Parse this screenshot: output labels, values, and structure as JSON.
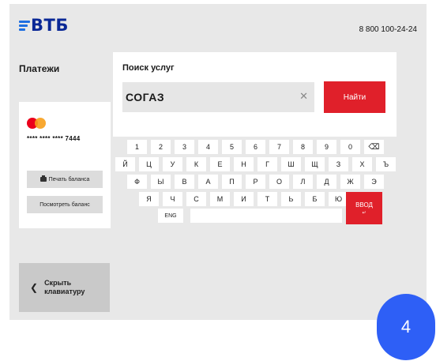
{
  "header": {
    "brand": "ВТБ",
    "phone": "8 800 100-24-24"
  },
  "left": {
    "title": "Платежи",
    "card_number": "**** **** **** 7444",
    "print_balance_label": "Печать баланса",
    "view_balance_label": "Посмотреть баланс",
    "hide_keyboard_label": "Скрыть клавиатуру"
  },
  "search": {
    "title": "Поиск услуг",
    "value": "СОГАЗ",
    "clear_icon": "✕",
    "find_label": "Найти"
  },
  "keyboard": {
    "row1": [
      "1",
      "2",
      "3",
      "4",
      "5",
      "6",
      "7",
      "8",
      "9",
      "0",
      "⌫"
    ],
    "row2": [
      "Й",
      "Ц",
      "У",
      "К",
      "Е",
      "Н",
      "Г",
      "Ш",
      "Щ",
      "З",
      "Х",
      "Ъ"
    ],
    "row3": [
      "Ф",
      "Ы",
      "В",
      "А",
      "П",
      "Р",
      "О",
      "Л",
      "Д",
      "Ж",
      "Э"
    ],
    "row4": [
      "Я",
      "Ч",
      "С",
      "М",
      "И",
      "Т",
      "Ь",
      "Б",
      "Ю"
    ],
    "lang_label": "ENG",
    "enter_label": "ВВОД",
    "enter_sub": "↵"
  },
  "step_badge": "4",
  "colors": {
    "brand_blue": "#0a2896",
    "accent_red": "#e0202a",
    "badge_blue": "#2e5ff6"
  }
}
